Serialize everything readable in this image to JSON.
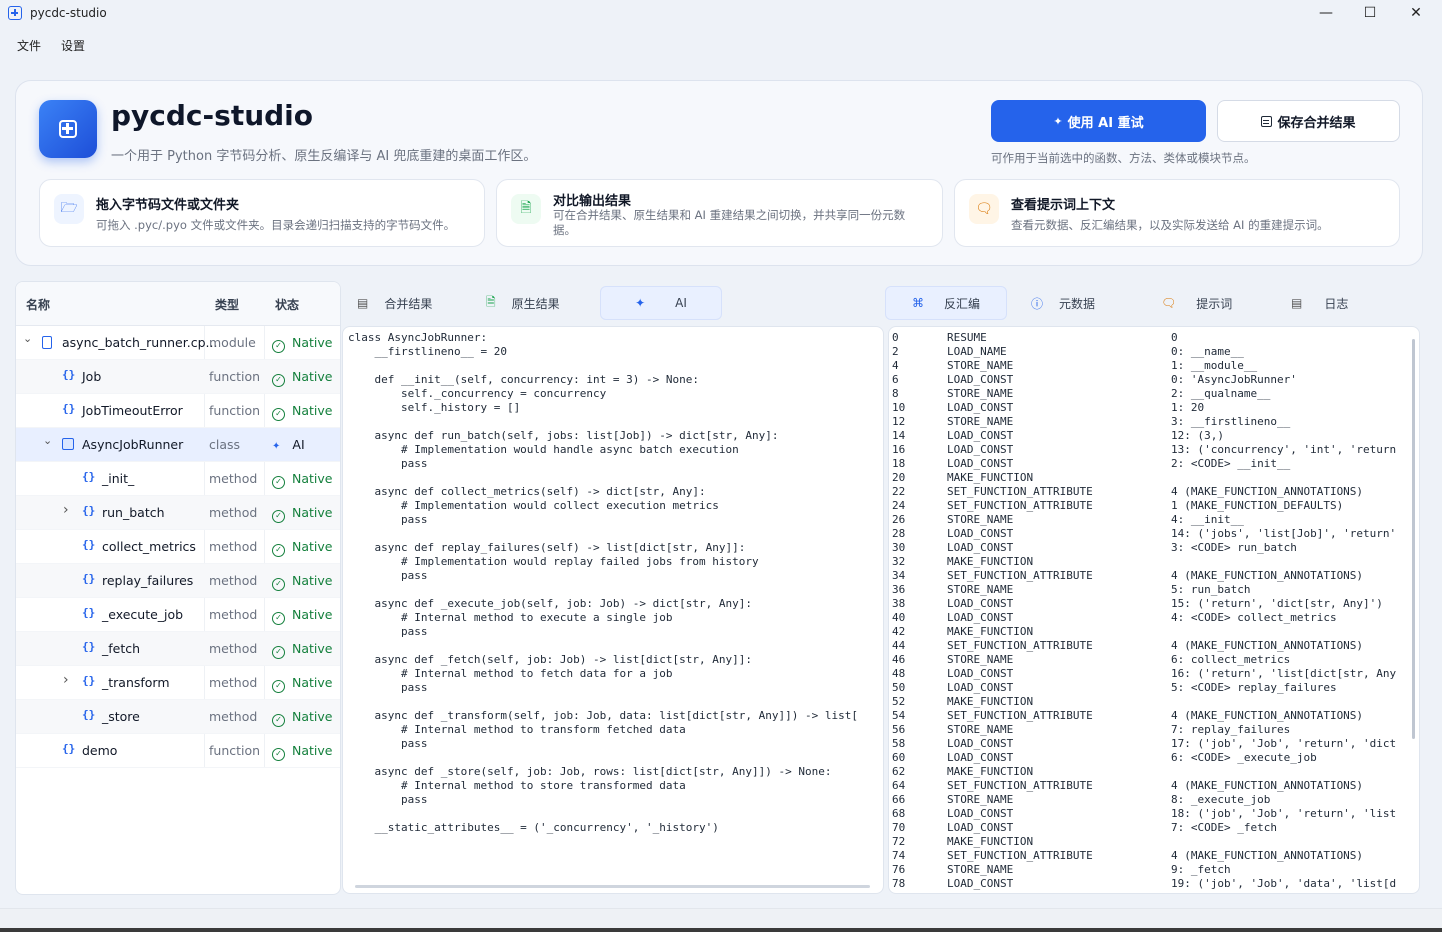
{
  "window": {
    "title": "pycdc-studio"
  },
  "menu": [
    "文件",
    "设置"
  ],
  "header": {
    "app_name": "pycdc-studio",
    "subtitle": "一个用于 Python 字节码分析、原生反编译与 AI 兜底重建的桌面工作区。",
    "retry_ai_label": "使用 AI 重试",
    "save_merged_label": "保存合并结果",
    "hint": "可作用于当前选中的函数、方法、类体或模块节点。"
  },
  "cards": [
    {
      "title": "拖入字节码文件或文件夹",
      "desc": "可拖入 .pyc/.pyo 文件或文件夹。目录会递归扫描支持的字节码文件。",
      "icon": "folder-open-icon"
    },
    {
      "title": "对比输出结果",
      "desc": "可在合并结果、原生结果和 AI 重建结果之间切换，并共享同一份元数据。",
      "icon": "file-compare-icon"
    },
    {
      "title": "查看提示词上下文",
      "desc": "查看元数据、反汇编结果，以及实际发送给 AI 的重建提示词。",
      "icon": "message-icon"
    }
  ],
  "tree": {
    "headers": {
      "name": "名称",
      "type": "类型",
      "status": "状态"
    },
    "rows": [
      {
        "name": "async_batch_runner.cp...",
        "type": "module",
        "status": "Native",
        "icon": "file-icon",
        "depth": 0,
        "expander": "expanded"
      },
      {
        "name": "Job",
        "type": "function",
        "status": "Native",
        "icon": "braces-icon",
        "depth": 1,
        "expander": "none"
      },
      {
        "name": "JobTimeoutError",
        "type": "function",
        "status": "Native",
        "icon": "braces-icon",
        "depth": 1,
        "expander": "none"
      },
      {
        "name": "AsyncJobRunner",
        "type": "class",
        "status": "AI",
        "icon": "class-icon",
        "depth": 1,
        "expander": "expanded"
      },
      {
        "name": "_init_",
        "type": "method",
        "status": "Native",
        "icon": "braces-icon",
        "depth": 2,
        "expander": "none"
      },
      {
        "name": "run_batch",
        "type": "method",
        "status": "Native",
        "icon": "braces-icon",
        "depth": 2,
        "expander": "collapsed"
      },
      {
        "name": "collect_metrics",
        "type": "method",
        "status": "Native",
        "icon": "braces-icon",
        "depth": 2,
        "expander": "none"
      },
      {
        "name": "replay_failures",
        "type": "method",
        "status": "Native",
        "icon": "braces-icon",
        "depth": 2,
        "expander": "none"
      },
      {
        "name": "_execute_job",
        "type": "method",
        "status": "Native",
        "icon": "braces-icon",
        "depth": 2,
        "expander": "none"
      },
      {
        "name": "_fetch",
        "type": "method",
        "status": "Native",
        "icon": "braces-icon",
        "depth": 2,
        "expander": "none"
      },
      {
        "name": "_transform",
        "type": "method",
        "status": "Native",
        "icon": "braces-icon",
        "depth": 2,
        "expander": "collapsed"
      },
      {
        "name": "_store",
        "type": "method",
        "status": "Native",
        "icon": "braces-icon",
        "depth": 2,
        "expander": "none"
      },
      {
        "name": "demo",
        "type": "function",
        "status": "Native",
        "icon": "braces-icon",
        "depth": 1,
        "expander": "none"
      }
    ]
  },
  "mid_tabs": [
    {
      "label": "合并结果",
      "icon": "merge-doc-icon",
      "active": false
    },
    {
      "label": "原生结果",
      "icon": "file-code-icon",
      "active": false
    },
    {
      "label": "AI",
      "icon": "sparkle-icon",
      "active": true
    }
  ],
  "right_tabs": [
    {
      "label": "反汇编",
      "icon": "disasm-icon",
      "active": true
    },
    {
      "label": "元数据",
      "icon": "info-icon",
      "active": false
    },
    {
      "label": "提示词",
      "icon": "chat-icon",
      "active": false
    },
    {
      "label": "日志",
      "icon": "log-icon",
      "active": false
    }
  ],
  "ai_code": "class AsyncJobRunner:\n    __firstlineno__ = 20\n\n    def __init__(self, concurrency: int = 3) -> None:\n        self._concurrency = concurrency\n        self._history = []\n\n    async def run_batch(self, jobs: list[Job]) -> dict[str, Any]:\n        # Implementation would handle async batch execution\n        pass\n\n    async def collect_metrics(self) -> dict[str, Any]:\n        # Implementation would collect execution metrics\n        pass\n\n    async def replay_failures(self) -> list[dict[str, Any]]:\n        # Implementation would replay failed jobs from history\n        pass\n\n    async def _execute_job(self, job: Job) -> dict[str, Any]:\n        # Internal method to execute a single job\n        pass\n\n    async def _fetch(self, job: Job) -> list[dict[str, Any]]:\n        # Internal method to fetch data for a job\n        pass\n\n    async def _transform(self, job: Job, data: list[dict[str, Any]]) -> list[\n        # Internal method to transform fetched data\n        pass\n\n    async def _store(self, job: Job, rows: list[dict[str, Any]]) -> None:\n        # Internal method to store transformed data\n        pass\n\n    __static_attributes__ = ('_concurrency', '_history')",
  "disasm": {
    "offsets": "0\n2\n4\n6\n8\n10\n12\n14\n16\n18\n20\n22\n24\n26\n28\n30\n32\n34\n36\n38\n40\n42\n44\n46\n48\n50\n52\n54\n56\n58\n60\n62\n64\n66\n68\n70\n72\n74\n76\n78",
    "opcodes": "RESUME\nLOAD_NAME\nSTORE_NAME\nLOAD_CONST\nSTORE_NAME\nLOAD_CONST\nSTORE_NAME\nLOAD_CONST\nLOAD_CONST\nLOAD_CONST\nMAKE_FUNCTION\nSET_FUNCTION_ATTRIBUTE\nSET_FUNCTION_ATTRIBUTE\nSTORE_NAME\nLOAD_CONST\nLOAD_CONST\nMAKE_FUNCTION\nSET_FUNCTION_ATTRIBUTE\nSTORE_NAME\nLOAD_CONST\nLOAD_CONST\nMAKE_FUNCTION\nSET_FUNCTION_ATTRIBUTE\nSTORE_NAME\nLOAD_CONST\nLOAD_CONST\nMAKE_FUNCTION\nSET_FUNCTION_ATTRIBUTE\nSTORE_NAME\nLOAD_CONST\nLOAD_CONST\nMAKE_FUNCTION\nSET_FUNCTION_ATTRIBUTE\nSTORE_NAME\nLOAD_CONST\nLOAD_CONST\nMAKE_FUNCTION\nSET_FUNCTION_ATTRIBUTE\nSTORE_NAME\nLOAD_CONST",
    "args": "0\n0: __name__\n1: __module__\n0: 'AsyncJobRunner'\n2: __qualname__\n1: 20\n3: __firstlineno__\n12: (3,)\n13: ('concurrency', 'int', 'return\n2: <CODE> __init__\n\n4 (MAKE_FUNCTION_ANNOTATIONS)\n1 (MAKE_FUNCTION_DEFAULTS)\n4: __init__\n14: ('jobs', 'list[Job]', 'return'\n3: <CODE> run_batch\n\n4 (MAKE_FUNCTION_ANNOTATIONS)\n5: run_batch\n15: ('return', 'dict[str, Any]')\n4: <CODE> collect_metrics\n\n4 (MAKE_FUNCTION_ANNOTATIONS)\n6: collect_metrics\n16: ('return', 'list[dict[str, Any\n5: <CODE> replay_failures\n\n4 (MAKE_FUNCTION_ANNOTATIONS)\n7: replay_failures\n17: ('job', 'Job', 'return', 'dict\n6: <CODE> _execute_job\n\n4 (MAKE_FUNCTION_ANNOTATIONS)\n8: _execute_job\n18: ('job', 'Job', 'return', 'list\n7: <CODE> _fetch\n\n4 (MAKE_FUNCTION_ANNOTATIONS)\n9: _fetch\n19: ('job', 'Job', 'data', 'list[d"
  }
}
